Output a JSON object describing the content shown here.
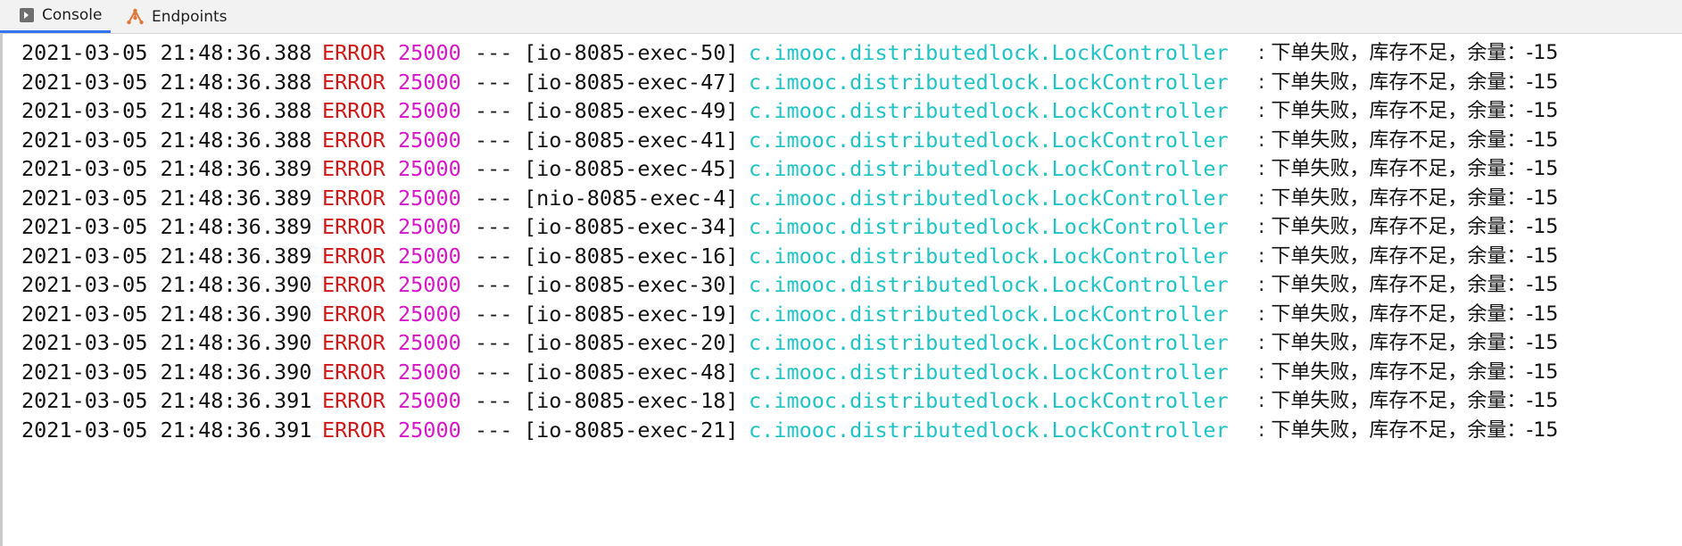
{
  "tabs": [
    {
      "label": "Console",
      "icon": "console-icon",
      "active": true
    },
    {
      "label": "Endpoints",
      "icon": "endpoints-icon",
      "active": false
    }
  ],
  "colors": {
    "level": "#d01717",
    "pid": "#d616c8",
    "logger": "#1fc3c6",
    "active_tab_underline": "#3574f0"
  },
  "log_lines": [
    {
      "timestamp": "2021-03-05 21:48:36.388",
      "level": "ERROR",
      "pid": "25000",
      "separator": "---",
      "thread": "[io-8085-exec-50]",
      "logger": "c.imooc.distributedlock.LockController",
      "message": ": 下单失败，库存不足，余量：-15"
    },
    {
      "timestamp": "2021-03-05 21:48:36.388",
      "level": "ERROR",
      "pid": "25000",
      "separator": "---",
      "thread": "[io-8085-exec-47]",
      "logger": "c.imooc.distributedlock.LockController",
      "message": ": 下单失败，库存不足，余量：-15"
    },
    {
      "timestamp": "2021-03-05 21:48:36.388",
      "level": "ERROR",
      "pid": "25000",
      "separator": "---",
      "thread": "[io-8085-exec-49]",
      "logger": "c.imooc.distributedlock.LockController",
      "message": ": 下单失败，库存不足，余量：-15"
    },
    {
      "timestamp": "2021-03-05 21:48:36.388",
      "level": "ERROR",
      "pid": "25000",
      "separator": "---",
      "thread": "[io-8085-exec-41]",
      "logger": "c.imooc.distributedlock.LockController",
      "message": ": 下单失败，库存不足，余量：-15"
    },
    {
      "timestamp": "2021-03-05 21:48:36.389",
      "level": "ERROR",
      "pid": "25000",
      "separator": "---",
      "thread": "[io-8085-exec-45]",
      "logger": "c.imooc.distributedlock.LockController",
      "message": ": 下单失败，库存不足，余量：-15"
    },
    {
      "timestamp": "2021-03-05 21:48:36.389",
      "level": "ERROR",
      "pid": "25000",
      "separator": "---",
      "thread": "[nio-8085-exec-4]",
      "logger": "c.imooc.distributedlock.LockController",
      "message": ": 下单失败，库存不足，余量：-15"
    },
    {
      "timestamp": "2021-03-05 21:48:36.389",
      "level": "ERROR",
      "pid": "25000",
      "separator": "---",
      "thread": "[io-8085-exec-34]",
      "logger": "c.imooc.distributedlock.LockController",
      "message": ": 下单失败，库存不足，余量：-15"
    },
    {
      "timestamp": "2021-03-05 21:48:36.389",
      "level": "ERROR",
      "pid": "25000",
      "separator": "---",
      "thread": "[io-8085-exec-16]",
      "logger": "c.imooc.distributedlock.LockController",
      "message": ": 下单失败，库存不足，余量：-15"
    },
    {
      "timestamp": "2021-03-05 21:48:36.390",
      "level": "ERROR",
      "pid": "25000",
      "separator": "---",
      "thread": "[io-8085-exec-30]",
      "logger": "c.imooc.distributedlock.LockController",
      "message": ": 下单失败，库存不足，余量：-15"
    },
    {
      "timestamp": "2021-03-05 21:48:36.390",
      "level": "ERROR",
      "pid": "25000",
      "separator": "---",
      "thread": "[io-8085-exec-19]",
      "logger": "c.imooc.distributedlock.LockController",
      "message": ": 下单失败，库存不足，余量：-15"
    },
    {
      "timestamp": "2021-03-05 21:48:36.390",
      "level": "ERROR",
      "pid": "25000",
      "separator": "---",
      "thread": "[io-8085-exec-20]",
      "logger": "c.imooc.distributedlock.LockController",
      "message": ": 下单失败，库存不足，余量：-15"
    },
    {
      "timestamp": "2021-03-05 21:48:36.390",
      "level": "ERROR",
      "pid": "25000",
      "separator": "---",
      "thread": "[io-8085-exec-48]",
      "logger": "c.imooc.distributedlock.LockController",
      "message": ": 下单失败，库存不足，余量：-15"
    },
    {
      "timestamp": "2021-03-05 21:48:36.391",
      "level": "ERROR",
      "pid": "25000",
      "separator": "---",
      "thread": "[io-8085-exec-18]",
      "logger": "c.imooc.distributedlock.LockController",
      "message": ": 下单失败，库存不足，余量：-15"
    },
    {
      "timestamp": "2021-03-05 21:48:36.391",
      "level": "ERROR",
      "pid": "25000",
      "separator": "---",
      "thread": "[io-8085-exec-21]",
      "logger": "c.imooc.distributedlock.LockController",
      "message": ": 下单失败，库存不足，余量：-15"
    }
  ]
}
